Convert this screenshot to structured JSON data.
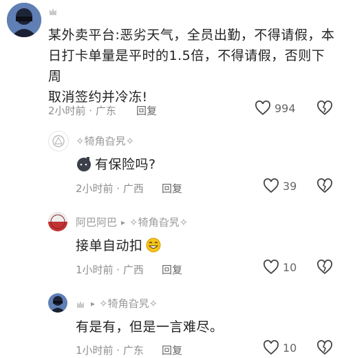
{
  "comments": [
    {
      "author": "",
      "badge": "crown",
      "text_lines": [
        "某外卖平台:恶劣天气，全员出勤，不得请假，本",
        "日打卡单量是平时的1.5倍，不得请假，否则下周",
        "取消签约并冷冻!"
      ],
      "time": "2小时前 · 广东",
      "reply": "回复",
      "likes": "994"
    },
    {
      "author": "✧犄角旮旯✧",
      "text": "有保险吗?",
      "time": "2小时前 · 广西",
      "reply": "回复",
      "likes": "39"
    },
    {
      "author": "阿巴阿巴",
      "reply_arrow": "▸",
      "reply_to": "✧犄角旮旯✧",
      "text": "接单自动扣",
      "time": "1小时前 · 广西",
      "reply": "回复",
      "likes": "10"
    },
    {
      "author": "",
      "badge": "crown",
      "reply_arrow": "▸",
      "reply_to": "✧犄角旮旯✧",
      "text": "有是有，但是一言难尽。",
      "time": "1小时前 · 广东",
      "reply": "回复",
      "likes": "10"
    }
  ]
}
